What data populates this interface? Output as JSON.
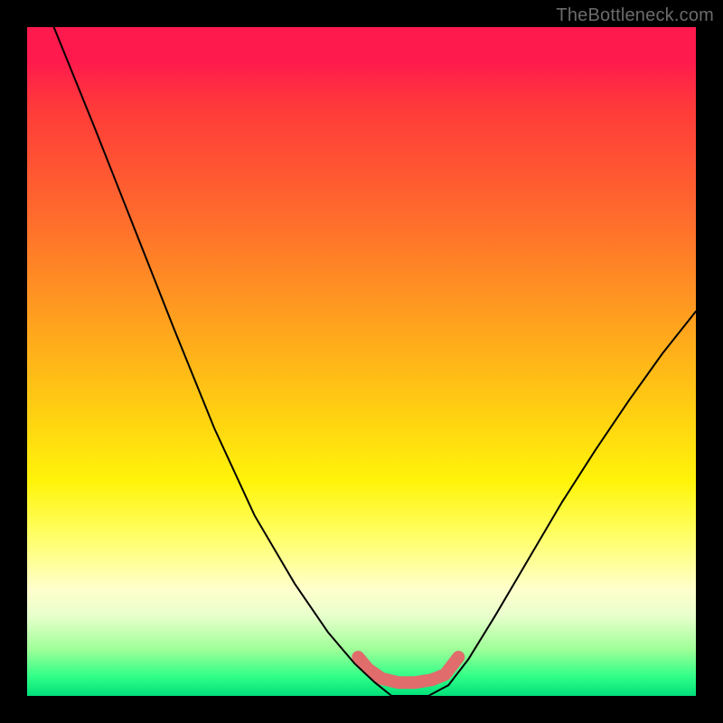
{
  "watermark": "TheBottleneck.com",
  "chart_data": {
    "type": "line",
    "title": "",
    "xlabel": "",
    "ylabel": "",
    "xlim": [
      0,
      1
    ],
    "ylim": [
      0,
      1
    ],
    "grid": false,
    "legend": false,
    "series": [
      {
        "name": "bottleneck-curve",
        "color": "#000000",
        "stroke_width": 2,
        "points": [
          {
            "x": 0.04,
            "y": 1.0
          },
          {
            "x": 0.1,
            "y": 0.852
          },
          {
            "x": 0.16,
            "y": 0.7
          },
          {
            "x": 0.22,
            "y": 0.548
          },
          {
            "x": 0.28,
            "y": 0.4
          },
          {
            "x": 0.34,
            "y": 0.27
          },
          {
            "x": 0.4,
            "y": 0.168
          },
          {
            "x": 0.45,
            "y": 0.095
          },
          {
            "x": 0.49,
            "y": 0.048
          },
          {
            "x": 0.52,
            "y": 0.02
          },
          {
            "x": 0.545,
            "y": 0.0
          },
          {
            "x": 0.57,
            "y": 0.0
          },
          {
            "x": 0.6,
            "y": 0.0
          },
          {
            "x": 0.63,
            "y": 0.016
          },
          {
            "x": 0.66,
            "y": 0.055
          },
          {
            "x": 0.7,
            "y": 0.12
          },
          {
            "x": 0.75,
            "y": 0.205
          },
          {
            "x": 0.8,
            "y": 0.29
          },
          {
            "x": 0.85,
            "y": 0.368
          },
          {
            "x": 0.9,
            "y": 0.442
          },
          {
            "x": 0.95,
            "y": 0.512
          },
          {
            "x": 1.0,
            "y": 0.575
          }
        ]
      },
      {
        "name": "sweet-spot-marker",
        "color": "#e06c6c",
        "stroke_width": 14,
        "linecap": "round",
        "points": [
          {
            "x": 0.495,
            "y": 0.058
          },
          {
            "x": 0.51,
            "y": 0.04
          },
          {
            "x": 0.53,
            "y": 0.026
          },
          {
            "x": 0.555,
            "y": 0.02
          },
          {
            "x": 0.58,
            "y": 0.02
          },
          {
            "x": 0.605,
            "y": 0.024
          },
          {
            "x": 0.625,
            "y": 0.032
          },
          {
            "x": 0.645,
            "y": 0.058
          }
        ]
      }
    ],
    "bg_gradient_stops": [
      {
        "t": 0.0,
        "color": "#ff1a4d"
      },
      {
        "t": 0.05,
        "color": "#ff1a4d"
      },
      {
        "t": 0.12,
        "color": "#ff3a3a"
      },
      {
        "t": 0.28,
        "color": "#ff6a2d"
      },
      {
        "t": 0.42,
        "color": "#ff9a20"
      },
      {
        "t": 0.56,
        "color": "#ffca13"
      },
      {
        "t": 0.68,
        "color": "#fff40a"
      },
      {
        "t": 0.76,
        "color": "#ffff66"
      },
      {
        "t": 0.84,
        "color": "#ffffcc"
      },
      {
        "t": 0.88,
        "color": "#e8ffcc"
      },
      {
        "t": 0.93,
        "color": "#a0ff99"
      },
      {
        "t": 0.97,
        "color": "#33ff88"
      },
      {
        "t": 1.0,
        "color": "#00e07a"
      }
    ]
  }
}
